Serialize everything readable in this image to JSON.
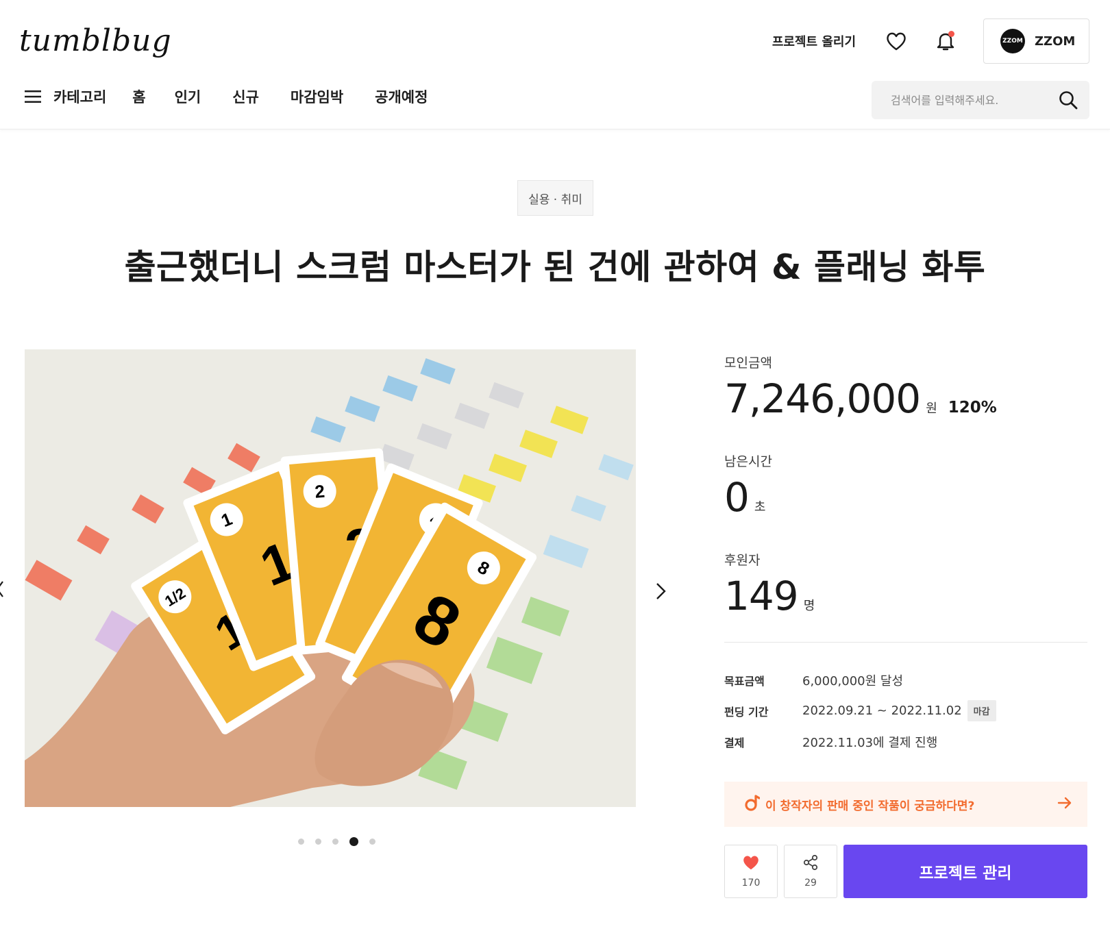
{
  "header": {
    "logo": "tumblbug",
    "upload_label": "프로젝트 올리기",
    "profile": {
      "avatar_text": "ZZOM",
      "name": "ZZOM"
    },
    "icons": [
      "heart-icon",
      "bell-icon"
    ]
  },
  "nav": {
    "category_label": "카테고리",
    "items": [
      "홈",
      "인기",
      "신규",
      "마감임박",
      "공개예정"
    ]
  },
  "search": {
    "placeholder": "검색어를 입력해주세요."
  },
  "project": {
    "category": "실용 · 취미",
    "title": "출근했더니 스크럼 마스터가 된 건에 관하여 & 플래닝 화투"
  },
  "carousel": {
    "card_labels": [
      "1/2",
      "1",
      "2",
      "4",
      "8"
    ],
    "big_digits": [
      "1",
      "1",
      "2",
      "8"
    ],
    "dot_count": 5,
    "active_dot": 4
  },
  "stats": {
    "amount_label": "모인금액",
    "amount": "7,246,000",
    "amount_unit": "원",
    "percent": "120%",
    "time_label": "남은시간",
    "time": "0",
    "time_unit": "초",
    "backers_label": "후원자",
    "backers": "149",
    "backers_unit": "명"
  },
  "info": {
    "goal_key": "목표금액",
    "goal_val": "6,000,000원 달성",
    "period_key": "펀딩 기간",
    "period_val": "2022.09.21 ~ 2022.11.02",
    "deadline_tag": "마감",
    "payment_key": "결제",
    "payment_val": "2022.11.03에 결제 진행"
  },
  "creator_banner": {
    "text": "이 창작자의 판매 중인 작품이 궁금하다면?"
  },
  "actions": {
    "like_count": "170",
    "share_count": "29",
    "manage_label": "프로젝트 관리"
  },
  "colors": {
    "accent": "#6947f0",
    "banner_text": "#f26b2e",
    "banner_bg": "#fff4ee",
    "heart": "#f4554a"
  }
}
